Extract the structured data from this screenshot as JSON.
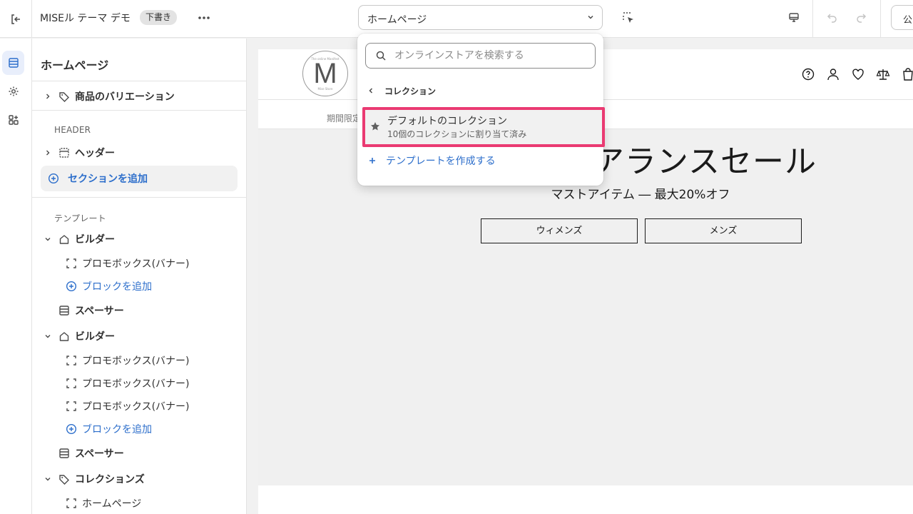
{
  "topbar": {
    "store_name": "MISEル テーマ デモ",
    "status_badge": "下書き",
    "page_selector": "ホームページ",
    "publish_label": "公開"
  },
  "sidebar": {
    "title": "ホームページ",
    "product_variations": "商品のバリエーション",
    "header_section_label": "HEADER",
    "header_item": "ヘッダー",
    "add_section": "セクションを追加",
    "template_section_label": "テンプレート",
    "items": [
      {
        "label": "ビルダー"
      },
      {
        "label": "プロモボックス(バナー)"
      },
      {
        "label": "ブロックを追加"
      },
      {
        "label": "スペーサー"
      },
      {
        "label": "ビルダー"
      },
      {
        "label": "プロモボックス(バナー)"
      },
      {
        "label": "プロモボックス(バナー)"
      },
      {
        "label": "プロモボックス(バナー)"
      },
      {
        "label": "ブロックを追加"
      },
      {
        "label": "スペーサー"
      },
      {
        "label": "コレクションズ"
      },
      {
        "label": "ホームページ"
      }
    ]
  },
  "dropdown": {
    "search_placeholder": "オンラインストアを検索する",
    "back_label": "コレクション",
    "item_title": "デフォルトのコレクション",
    "item_subtitle": "10個のコレクションに割り当て済み",
    "create_template": "テンプレートを作成する"
  },
  "preview": {
    "logo_letter": "M",
    "logo_top_text": "The online Manifest",
    "logo_bottom_text": "Mise Store",
    "hero_eyebrow": "期間限定：オンラインのみ！",
    "hero_title": "最終クリアランスセール",
    "hero_subtitle": "マストアイテム ― 最大20%オフ",
    "button_women": "ウィメンズ",
    "button_men": "メンズ"
  },
  "colors": {
    "accent_blue": "#2c6ecb",
    "highlight_pink": "#ea3a72",
    "hero_bg": "#f0f0f0"
  }
}
